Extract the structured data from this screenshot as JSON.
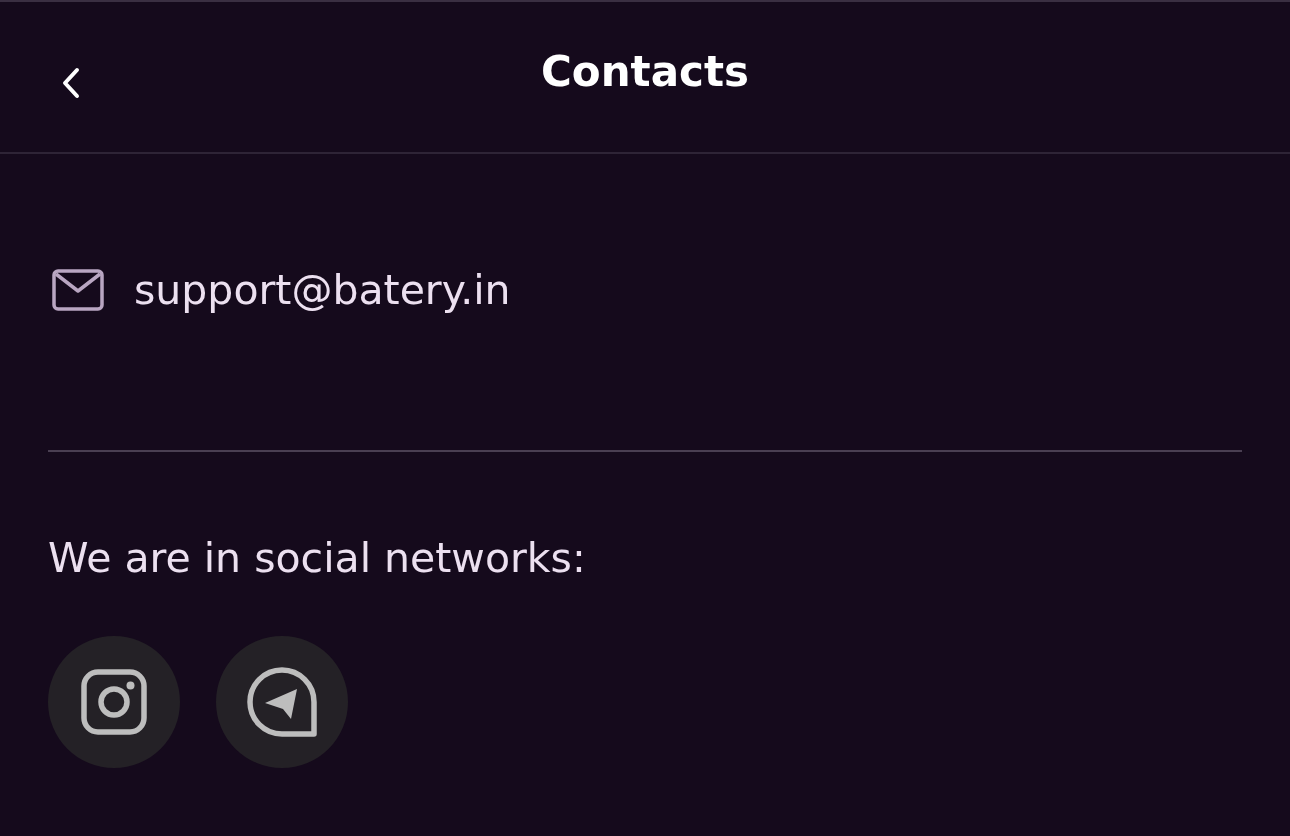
{
  "header": {
    "title": "Contacts"
  },
  "contact": {
    "email": "support@batery.in"
  },
  "social": {
    "heading": "We are in social networks:",
    "links": [
      {
        "kind": "instagram"
      },
      {
        "kind": "telegram"
      }
    ]
  }
}
